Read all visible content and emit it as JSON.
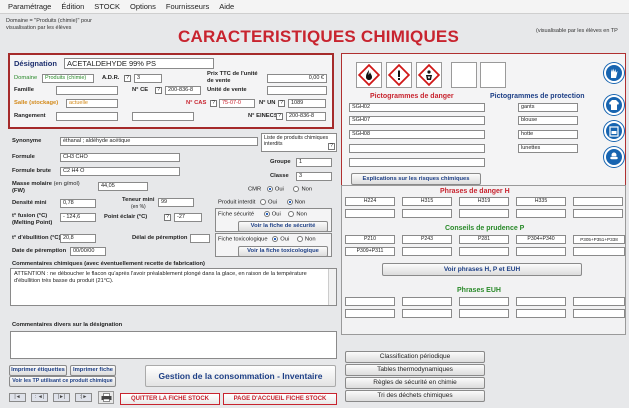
{
  "menu": [
    "Paramétrage",
    "Édition",
    "STOCK",
    "Options",
    "Fournisseurs",
    "Aide"
  ],
  "domain_note": "Domaine = \"Produits (chimie)\" pour visualisation par les élèves",
  "title": "CARACTERISTIQUES CHIMIQUES",
  "right_note": "(visualisable par les élèves en TP",
  "designation": {
    "label": "Désignation",
    "value": "ACETALDEHYDE 99% PS"
  },
  "domaine": {
    "label": "Domaine",
    "value": "Produits (chimie)"
  },
  "adr": {
    "label": "A.D.R.",
    "value": "3"
  },
  "prix": {
    "label": "Prix TTC de l'unité de vente",
    "value": "0,00 €"
  },
  "famille": {
    "label": "Famille",
    "value": ""
  },
  "nce": {
    "label": "N° CE",
    "value": "200-836-8"
  },
  "unite": {
    "label": "Unité de vente",
    "value": ""
  },
  "salle": {
    "label": "Salle (stockage)",
    "value": "actuelle"
  },
  "ncas": {
    "label": "N° CAS",
    "value": "75-07-0"
  },
  "nun": {
    "label": "N° UN",
    "value": "1089"
  },
  "rangement": {
    "label": "Rangement",
    "value": ""
  },
  "einecs": {
    "label": "N° EINECS",
    "value": "200-836-8"
  },
  "synonyme": {
    "label": "Synonyme",
    "value": "éthanal ; aldéhyde acétique"
  },
  "liste_interdits": "Liste de produits chimiques interdits",
  "formule": {
    "label": "Formule",
    "value": "CH3 CHO"
  },
  "groupe": {
    "label": "Groupe",
    "value": "1"
  },
  "formule_brute": {
    "label": "Formule brute",
    "value": "C2 H4 O"
  },
  "classe": {
    "label": "Classe",
    "value": "3"
  },
  "masse": {
    "label": "Masse molaire",
    "unit": "(en g/mol)",
    "sub": "(FW)",
    "value": "44,05"
  },
  "cmr": {
    "label": "CMR",
    "oui": "Oui",
    "non": "Non",
    "selected": "oui"
  },
  "densite": {
    "label": "Densité mini",
    "value": "0,78"
  },
  "teneur": {
    "label": "Teneur mini",
    "unit": "(en %)",
    "value": "99"
  },
  "produit_interdit": {
    "label": "Produit interdit",
    "oui": "Oui",
    "non": "Non",
    "selected": "non"
  },
  "fusion": {
    "label": "t° fusion (°C)",
    "sub": "(Melting Point)",
    "value": "- 124,6"
  },
  "eclair": {
    "label": "Point éclair (°C)",
    "value": "-27"
  },
  "fiche_securite": {
    "label": "Fiche sécurité",
    "oui": "Oui",
    "non": "Non",
    "selected": "oui",
    "button": "Voir la fiche de sécurité"
  },
  "ebullition": {
    "label": "t° d'ébullition (°C)",
    "value": "20,8"
  },
  "delai": {
    "label": "Délai de péremption",
    "value": ""
  },
  "fiche_tox": {
    "label": "Fiche toxicologique",
    "oui": "Oui",
    "non": "Non",
    "selected": "oui",
    "button": "Voir la fiche toxicologique"
  },
  "peremption": {
    "label": "Date de péremption",
    "value": "00/00/00"
  },
  "comments_chem": {
    "label": "Commentaires chimiques (avec éventuellement recette de fabrication)",
    "value": "ATTENTION : ne déboucher le flacon qu'après l'avoir préalablement plongé dans la glace, en raison de la température d'ébullition très basse du produit (21°C)."
  },
  "comments_desig": {
    "label": "Commentaires divers sur la désignation",
    "value": ""
  },
  "btn_etiquettes": "Imprimer étiquettes",
  "btn_fiche": "Imprimer fiche",
  "btn_tp": "Voir les TP utilisant ce produit chimique",
  "gestion": "Gestion de la consommation - Inventaire",
  "nav": [
    "|◄",
    ": ◄|",
    "|►|",
    ":|►"
  ],
  "btn_quitter": "QUITTER LA FICHE STOCK",
  "btn_accueil": "PAGE D'ACCUEIL FICHE STOCK",
  "pictos_danger_title": "Pictogrammes de danger",
  "pictos_protection_title": "Pictogrammes de protection",
  "danger_codes": [
    "SGH02",
    "SGH07",
    "SGH08",
    "",
    ""
  ],
  "protection": [
    "gants",
    "blouse",
    "hotte",
    "lunettes"
  ],
  "explications_btn": "Explications sur les risques chimiques",
  "phrases_h_title": "Phrases de danger H",
  "phrases_h": [
    "H224",
    "H315",
    "H319",
    "H335",
    ""
  ],
  "conseils_title": "Conseils de prudence P",
  "conseils_p": [
    "P210",
    "P243",
    "P281",
    "P304+P340",
    "P305+P351+P338",
    "P309+P311"
  ],
  "voir_phrases": "Voir phrases H, P et EUH",
  "euh_title": "Phrases EUH",
  "bottom_buttons": [
    "Classification périodique",
    "Tables thermodynamiques",
    "Règles de sécurité en chimie",
    "Tri des déchets chimiques"
  ]
}
